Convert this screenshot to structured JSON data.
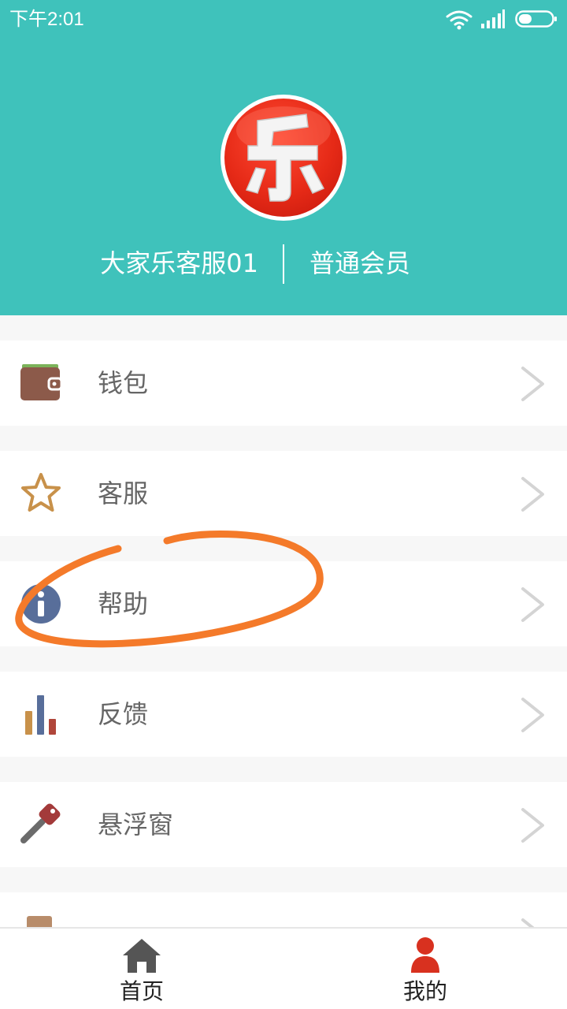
{
  "status_bar": {
    "time": "下午2:01"
  },
  "profile": {
    "name": "大家乐客服01",
    "level": "普通会员",
    "avatar_icon": "le-logo-avatar"
  },
  "menu": {
    "items": [
      {
        "label": "钱包",
        "icon": "wallet-icon"
      },
      {
        "label": "客服",
        "icon": "star-icon"
      },
      {
        "label": "帮助",
        "icon": "info-icon"
      },
      {
        "label": "反馈",
        "icon": "bar-chart-icon"
      },
      {
        "label": "悬浮窗",
        "icon": "key-icon"
      }
    ]
  },
  "tab_bar": {
    "tabs": [
      {
        "label": "首页",
        "icon": "home-icon"
      },
      {
        "label": "我的",
        "icon": "person-icon",
        "active": true
      }
    ]
  },
  "colors": {
    "header_bg": "#3fc2bb",
    "active_tab": "#d8311f",
    "annotation_stroke": "#f47a2a"
  }
}
